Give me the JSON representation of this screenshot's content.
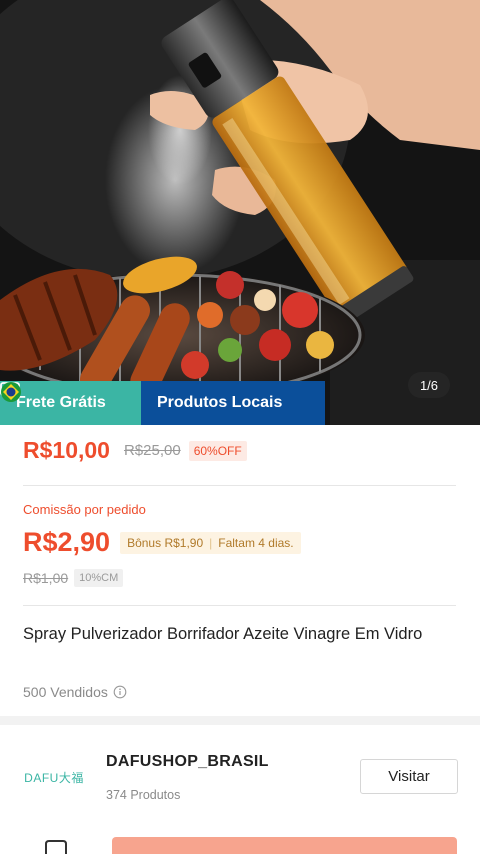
{
  "hero": {
    "image_counter": "1/6",
    "badges": {
      "frete": "Frete Grátis",
      "locais": "Produtos Locais"
    }
  },
  "price": {
    "current": "R$10,00",
    "original": "R$25,00",
    "discount": "60%OFF"
  },
  "commission": {
    "label": "Comissão por pedido",
    "value": "R$2,90",
    "bonus": "Bônus R$1,90",
    "remaining": "Faltam 4 dias.",
    "old_value": "R$1,00",
    "rate": "10%CM"
  },
  "product": {
    "title": "Spray Pulverizador Borrifador Azeite Vinagre Em Vidro",
    "sold": "500 Vendidos"
  },
  "shop": {
    "logo_text": "DAFU大福",
    "name": "DAFUSHOP_BRASIL",
    "products": "374 Produtos",
    "visit_label": "Visitar"
  },
  "colors": {
    "accent": "#ee4d2d",
    "frete_badge": "#3bb5a4",
    "locais_badge": "#0b4f9a",
    "bonus_text": "#b07a2a"
  },
  "icons": {
    "frete": "ticket-icon",
    "locais": "brazil-flag-icon",
    "sold_info": "info-icon"
  }
}
